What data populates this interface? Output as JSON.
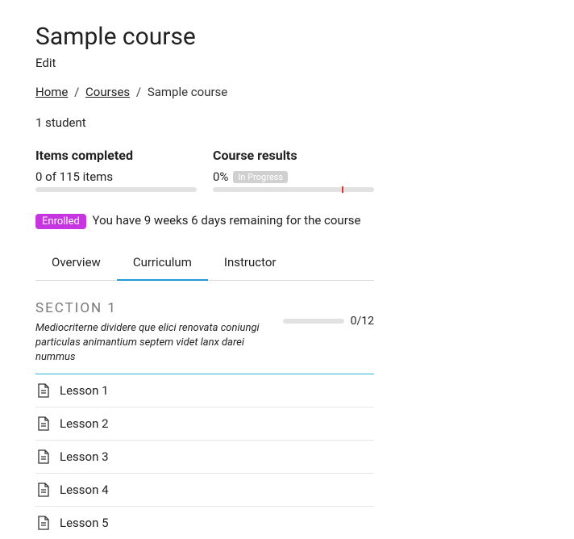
{
  "page": {
    "title": "Sample course",
    "edit": "Edit"
  },
  "breadcrumb": {
    "home": "Home",
    "courses": "Courses",
    "current": "Sample course",
    "sep": "/"
  },
  "students": "1 student",
  "stats": {
    "completed": {
      "title": "Items completed",
      "value": "0 of 115 items"
    },
    "results": {
      "title": "Course results",
      "percent": "0%",
      "status": "In Progress"
    }
  },
  "enroll": {
    "badge": "Enrolled",
    "text": "You have 9 weeks 6 days remaining for the course"
  },
  "tabs": {
    "overview": "Overview",
    "curriculum": "Curriculum",
    "instructor": "Instructor"
  },
  "section": {
    "title": "SECTION 1",
    "desc": "Mediocriterne dividere que elici renovata coniungi particulas animantium septem videt lanx darei nummus",
    "count": "0/12",
    "lessons": [
      "Lesson 1",
      "Lesson 2",
      "Lesson 3",
      "Lesson 4",
      "Lesson 5"
    ]
  }
}
